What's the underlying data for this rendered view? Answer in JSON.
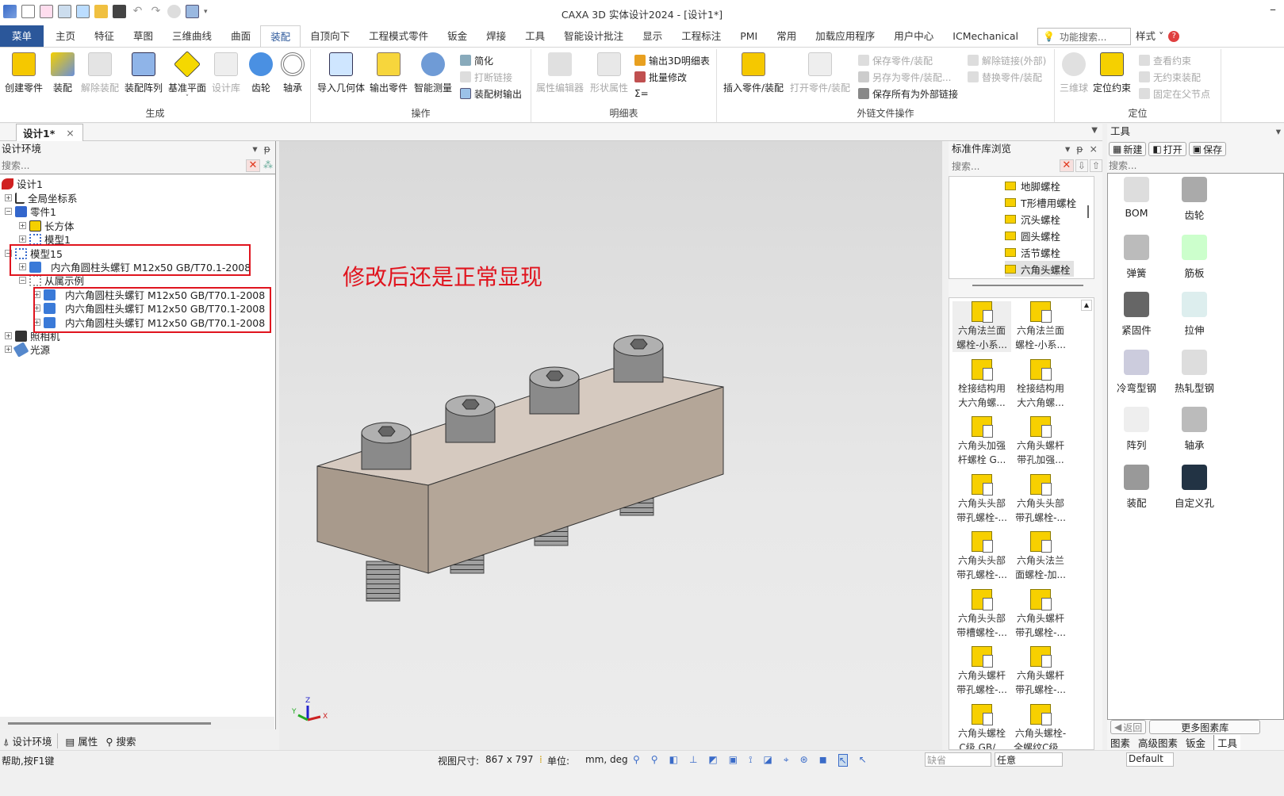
{
  "window": {
    "title": "CAXA 3D 实体设计2024 - [设计1*]"
  },
  "quick_access": [
    "app-logo-icon",
    "new-icon",
    "open-icon",
    "import-icon",
    "export-icon",
    "folder-icon",
    "save-icon",
    "undo-icon",
    "redo-icon",
    "sphere-icon",
    "design-tree-icon"
  ],
  "menu_tabs": [
    {
      "label": "菜单"
    },
    {
      "label": "主页"
    },
    {
      "label": "特征"
    },
    {
      "label": "草图"
    },
    {
      "label": "三维曲线"
    },
    {
      "label": "曲面"
    },
    {
      "label": "装配"
    },
    {
      "label": "自顶向下"
    },
    {
      "label": "工程模式零件"
    },
    {
      "label": "钣金"
    },
    {
      "label": "焊接"
    },
    {
      "label": "工具"
    },
    {
      "label": "智能设计批注"
    },
    {
      "label": "显示"
    },
    {
      "label": "工程标注"
    },
    {
      "label": "PMI"
    },
    {
      "label": "常用"
    },
    {
      "label": "加载应用程序"
    },
    {
      "label": "用户中心"
    },
    {
      "label": "ICMechanical"
    }
  ],
  "active_tab": "装配",
  "feature_search": {
    "placeholder": "功能搜索..."
  },
  "style_label": "样式",
  "ribbon": {
    "groups": [
      {
        "label": "生成",
        "big": [
          {
            "label": "创建零件",
            "enabled": true
          },
          {
            "label": "装配",
            "enabled": true
          },
          {
            "label": "解除装配",
            "enabled": false
          },
          {
            "label": "装配阵列",
            "enabled": true
          },
          {
            "label": "基准平面",
            "enabled": true
          },
          {
            "label": "设计库",
            "enabled": false
          },
          {
            "label": "齿轮",
            "enabled": true
          },
          {
            "label": "轴承",
            "enabled": true
          }
        ]
      },
      {
        "label": "操作",
        "big": [
          {
            "label": "导入几何体",
            "enabled": true
          },
          {
            "label": "输出零件",
            "enabled": true
          },
          {
            "label": "智能测量",
            "enabled": true
          }
        ],
        "small": [
          {
            "label": "简化",
            "enabled": true
          },
          {
            "label": "打断链接",
            "enabled": false
          },
          {
            "label": "装配树输出",
            "enabled": true
          }
        ]
      },
      {
        "label": "明细表",
        "big": [
          {
            "label": "属性编辑器",
            "enabled": false
          },
          {
            "label": "形状属性",
            "enabled": false
          }
        ],
        "small": [
          {
            "label": "输出3D明细表",
            "enabled": true
          },
          {
            "label": "批量修改",
            "enabled": true
          },
          {
            "label": "Σ=",
            "enabled": true
          }
        ]
      },
      {
        "label": "外链文件操作",
        "big": [
          {
            "label": "插入零件/装配",
            "enabled": true
          },
          {
            "label": "打开零件/装配",
            "enabled": false
          }
        ],
        "small": [
          {
            "label": "保存零件/装配",
            "enabled": false
          },
          {
            "label": "另存为零件/装配...",
            "enabled": false
          },
          {
            "label": "保存所有为外部链接",
            "enabled": true
          },
          {
            "label": "解除链接(外部)",
            "enabled": false
          },
          {
            "label": "替换零件/装配",
            "enabled": false
          }
        ]
      },
      {
        "label": "定位",
        "big": [
          {
            "label": "三维球",
            "enabled": false
          },
          {
            "label": "定位约束",
            "enabled": true
          }
        ],
        "small": [
          {
            "label": "查看约束",
            "enabled": false
          },
          {
            "label": "无约束装配",
            "enabled": false
          },
          {
            "label": "固定在父节点",
            "enabled": false
          }
        ]
      }
    ]
  },
  "doc_tab": {
    "label": "设计1*"
  },
  "left_panel": {
    "title": "设计环境",
    "search_placeholder": "搜索...",
    "tree": [
      {
        "label": "设计1",
        "depth": 0
      },
      {
        "label": "全局坐标系",
        "depth": 1
      },
      {
        "label": "零件1",
        "depth": 1
      },
      {
        "label": "长方体",
        "depth": 2
      },
      {
        "label": "模型1",
        "depth": 2
      },
      {
        "label": "模型15",
        "depth": 1
      },
      {
        "label": "内六角圆柱头螺钉 M12x50 GB/T70.1-2008",
        "depth": 2
      },
      {
        "label": "从属示例",
        "depth": 2
      },
      {
        "label": "内六角圆柱头螺钉 M12x50 GB/T70.1-2008",
        "depth": 3
      },
      {
        "label": "内六角圆柱头螺钉 M12x50 GB/T70.1-2008",
        "depth": 3
      },
      {
        "label": "内六角圆柱头螺钉 M12x50 GB/T70.1-2008",
        "depth": 3
      },
      {
        "label": "照相机",
        "depth": 1
      },
      {
        "label": "光源",
        "depth": 1
      }
    ],
    "bottom_tabs": [
      {
        "label": "设计环境"
      },
      {
        "label": "属性"
      },
      {
        "label": "搜索"
      }
    ]
  },
  "viewport": {
    "annotation": "修改后还是正常显现",
    "axes": {
      "x": "X",
      "y": "Y",
      "z": "Z"
    }
  },
  "library": {
    "title": "标准件库浏览",
    "search_placeholder": "搜索...",
    "tree": [
      "地脚螺栓",
      "T形槽用螺栓",
      "沉头螺栓",
      "圆头螺栓",
      "活节螺栓",
      "六角头螺栓"
    ],
    "selected": "六角头螺栓",
    "items": [
      [
        "六角法兰面",
        "螺栓-小系..."
      ],
      [
        "六角法兰面",
        "螺栓-小系..."
      ],
      [
        "栓接结构用",
        "大六角螺..."
      ],
      [
        "栓接结构用",
        "大六角螺..."
      ],
      [
        "六角头加强",
        "杆螺栓 G..."
      ],
      [
        "六角头螺杆",
        "带孔加强..."
      ],
      [
        "六角头头部",
        "带孔螺栓-..."
      ],
      [
        "六角头头部",
        "带孔螺栓-..."
      ],
      [
        "六角头头部",
        "带孔螺栓-..."
      ],
      [
        "六角头法兰",
        "面螺栓-加..."
      ],
      [
        "六角头头部",
        "带槽螺栓-..."
      ],
      [
        "六角头螺杆",
        "带孔螺栓-..."
      ],
      [
        "六角头螺杆",
        "带孔螺栓-..."
      ],
      [
        "六角头螺杆",
        "带孔螺栓-..."
      ],
      [
        "六角头螺栓",
        "C级 GB/..."
      ],
      [
        "六角头螺栓-",
        "全螺纹C级..."
      ]
    ]
  },
  "tools": {
    "title": "工具",
    "buttons": [
      {
        "label": "新建"
      },
      {
        "label": "打开"
      },
      {
        "label": "保存"
      }
    ],
    "search_placeholder": "搜索...",
    "items": [
      {
        "label": "BOM"
      },
      {
        "label": "齿轮"
      },
      {
        "label": "弹簧"
      },
      {
        "label": "筋板"
      },
      {
        "label": "紧固件"
      },
      {
        "label": "拉伸"
      },
      {
        "label": "冷弯型钢"
      },
      {
        "label": "热轧型钢"
      },
      {
        "label": "阵列"
      },
      {
        "label": "轴承"
      },
      {
        "label": "装配"
      },
      {
        "label": "自定义孔"
      }
    ],
    "back_label": "返回",
    "more_label": "更多图素库",
    "bottom_tabs": [
      {
        "label": "图素"
      },
      {
        "label": "高级图素"
      },
      {
        "label": "钣金"
      },
      {
        "label": "工具"
      }
    ],
    "active_bottom_tab": "工具"
  },
  "status": {
    "help": "帮助,按F1键",
    "view_size_label": "视图尺寸:",
    "view_size": "867 x 797",
    "unit_label": "单位:",
    "unit": "mm, deg",
    "filter1": "缺省",
    "filter2": "任意",
    "preset": "Default"
  }
}
